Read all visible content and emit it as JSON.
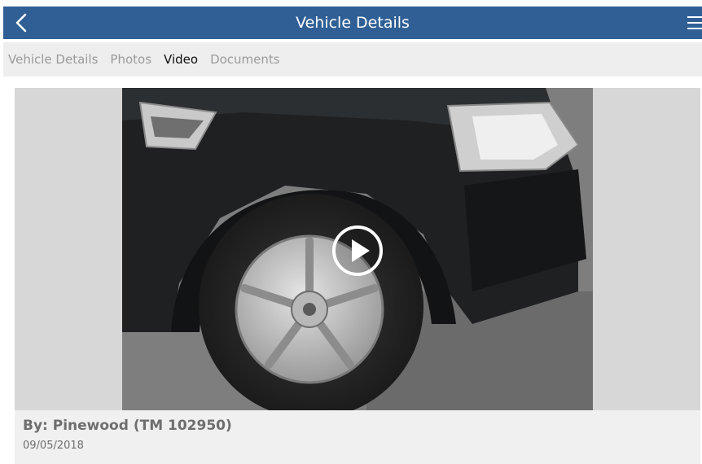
{
  "header": {
    "title": "Vehicle Details",
    "back_icon": "chevron-left-icon",
    "menu_icon": "hamburger-menu-icon",
    "background": "#2f5f95"
  },
  "tabs": [
    {
      "label": "Vehicle Details",
      "active": false
    },
    {
      "label": "Photos",
      "active": false
    },
    {
      "label": "Video",
      "active": true
    },
    {
      "label": "Documents",
      "active": false
    }
  ],
  "video": {
    "thumbnail_icon": "video-thumbnail",
    "play_icon": "play-circle-icon",
    "author": "By: Pinewood (TM 102950)",
    "date": "09/05/2018"
  }
}
